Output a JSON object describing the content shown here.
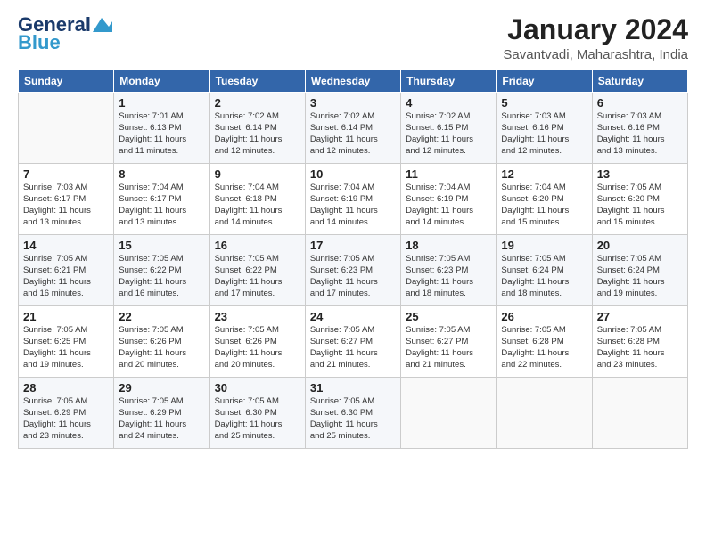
{
  "header": {
    "logo_line1": "General",
    "logo_line2": "Blue",
    "month": "January 2024",
    "location": "Savantvadi, Maharashtra, India"
  },
  "weekdays": [
    "Sunday",
    "Monday",
    "Tuesday",
    "Wednesday",
    "Thursday",
    "Friday",
    "Saturday"
  ],
  "weeks": [
    [
      {
        "day": "",
        "info": ""
      },
      {
        "day": "1",
        "info": "Sunrise: 7:01 AM\nSunset: 6:13 PM\nDaylight: 11 hours\nand 11 minutes."
      },
      {
        "day": "2",
        "info": "Sunrise: 7:02 AM\nSunset: 6:14 PM\nDaylight: 11 hours\nand 12 minutes."
      },
      {
        "day": "3",
        "info": "Sunrise: 7:02 AM\nSunset: 6:14 PM\nDaylight: 11 hours\nand 12 minutes."
      },
      {
        "day": "4",
        "info": "Sunrise: 7:02 AM\nSunset: 6:15 PM\nDaylight: 11 hours\nand 12 minutes."
      },
      {
        "day": "5",
        "info": "Sunrise: 7:03 AM\nSunset: 6:16 PM\nDaylight: 11 hours\nand 12 minutes."
      },
      {
        "day": "6",
        "info": "Sunrise: 7:03 AM\nSunset: 6:16 PM\nDaylight: 11 hours\nand 13 minutes."
      }
    ],
    [
      {
        "day": "7",
        "info": "Sunrise: 7:03 AM\nSunset: 6:17 PM\nDaylight: 11 hours\nand 13 minutes."
      },
      {
        "day": "8",
        "info": "Sunrise: 7:04 AM\nSunset: 6:17 PM\nDaylight: 11 hours\nand 13 minutes."
      },
      {
        "day": "9",
        "info": "Sunrise: 7:04 AM\nSunset: 6:18 PM\nDaylight: 11 hours\nand 14 minutes."
      },
      {
        "day": "10",
        "info": "Sunrise: 7:04 AM\nSunset: 6:19 PM\nDaylight: 11 hours\nand 14 minutes."
      },
      {
        "day": "11",
        "info": "Sunrise: 7:04 AM\nSunset: 6:19 PM\nDaylight: 11 hours\nand 14 minutes."
      },
      {
        "day": "12",
        "info": "Sunrise: 7:04 AM\nSunset: 6:20 PM\nDaylight: 11 hours\nand 15 minutes."
      },
      {
        "day": "13",
        "info": "Sunrise: 7:05 AM\nSunset: 6:20 PM\nDaylight: 11 hours\nand 15 minutes."
      }
    ],
    [
      {
        "day": "14",
        "info": "Sunrise: 7:05 AM\nSunset: 6:21 PM\nDaylight: 11 hours\nand 16 minutes."
      },
      {
        "day": "15",
        "info": "Sunrise: 7:05 AM\nSunset: 6:22 PM\nDaylight: 11 hours\nand 16 minutes."
      },
      {
        "day": "16",
        "info": "Sunrise: 7:05 AM\nSunset: 6:22 PM\nDaylight: 11 hours\nand 17 minutes."
      },
      {
        "day": "17",
        "info": "Sunrise: 7:05 AM\nSunset: 6:23 PM\nDaylight: 11 hours\nand 17 minutes."
      },
      {
        "day": "18",
        "info": "Sunrise: 7:05 AM\nSunset: 6:23 PM\nDaylight: 11 hours\nand 18 minutes."
      },
      {
        "day": "19",
        "info": "Sunrise: 7:05 AM\nSunset: 6:24 PM\nDaylight: 11 hours\nand 18 minutes."
      },
      {
        "day": "20",
        "info": "Sunrise: 7:05 AM\nSunset: 6:24 PM\nDaylight: 11 hours\nand 19 minutes."
      }
    ],
    [
      {
        "day": "21",
        "info": "Sunrise: 7:05 AM\nSunset: 6:25 PM\nDaylight: 11 hours\nand 19 minutes."
      },
      {
        "day": "22",
        "info": "Sunrise: 7:05 AM\nSunset: 6:26 PM\nDaylight: 11 hours\nand 20 minutes."
      },
      {
        "day": "23",
        "info": "Sunrise: 7:05 AM\nSunset: 6:26 PM\nDaylight: 11 hours\nand 20 minutes."
      },
      {
        "day": "24",
        "info": "Sunrise: 7:05 AM\nSunset: 6:27 PM\nDaylight: 11 hours\nand 21 minutes."
      },
      {
        "day": "25",
        "info": "Sunrise: 7:05 AM\nSunset: 6:27 PM\nDaylight: 11 hours\nand 21 minutes."
      },
      {
        "day": "26",
        "info": "Sunrise: 7:05 AM\nSunset: 6:28 PM\nDaylight: 11 hours\nand 22 minutes."
      },
      {
        "day": "27",
        "info": "Sunrise: 7:05 AM\nSunset: 6:28 PM\nDaylight: 11 hours\nand 23 minutes."
      }
    ],
    [
      {
        "day": "28",
        "info": "Sunrise: 7:05 AM\nSunset: 6:29 PM\nDaylight: 11 hours\nand 23 minutes."
      },
      {
        "day": "29",
        "info": "Sunrise: 7:05 AM\nSunset: 6:29 PM\nDaylight: 11 hours\nand 24 minutes."
      },
      {
        "day": "30",
        "info": "Sunrise: 7:05 AM\nSunset: 6:30 PM\nDaylight: 11 hours\nand 25 minutes."
      },
      {
        "day": "31",
        "info": "Sunrise: 7:05 AM\nSunset: 6:30 PM\nDaylight: 11 hours\nand 25 minutes."
      },
      {
        "day": "",
        "info": ""
      },
      {
        "day": "",
        "info": ""
      },
      {
        "day": "",
        "info": ""
      }
    ]
  ]
}
